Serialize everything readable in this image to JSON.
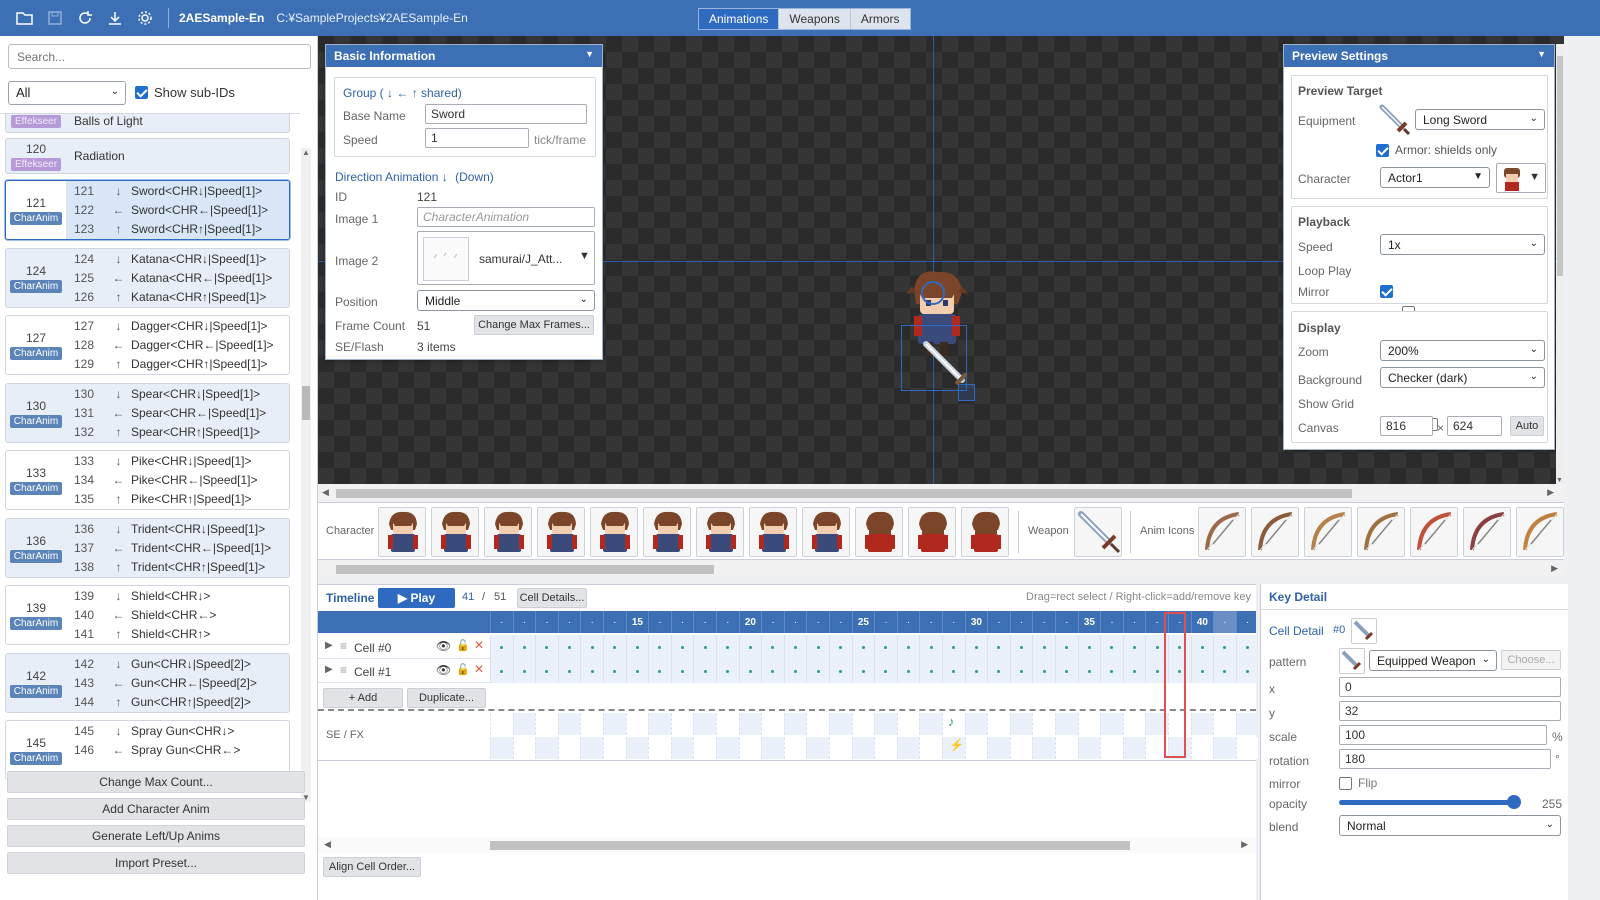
{
  "topbar": {
    "project_name": "2AESample-En",
    "project_path": "C:¥SampleProjects¥2AESample-En",
    "tabs": [
      "Animations",
      "Weapons",
      "Armors"
    ],
    "active_tab": "Animations",
    "icons": [
      "folder-open-icon",
      "save-icon",
      "refresh-icon",
      "download-icon",
      "gear-icon"
    ]
  },
  "sidebar": {
    "search_placeholder": "Search...",
    "filter_value": "All",
    "show_subids_label": "Show sub-IDs",
    "show_subids_checked": true,
    "groups": [
      {
        "id": "",
        "badge": "Effekseer",
        "rows": [
          {
            "id": "",
            "dir": "",
            "name": "Balls of Light"
          }
        ]
      },
      {
        "id": "120",
        "badge": "Effekseer",
        "rows": [
          {
            "id": "",
            "dir": "",
            "name": "Radiation"
          }
        ]
      },
      {
        "id": "121",
        "badge": "CharAnim",
        "rows": [
          {
            "id": "121",
            "dir": "↓",
            "name": "Sword<CHR↓|Speed[1]>"
          },
          {
            "id": "122",
            "dir": "←",
            "name": "Sword<CHR←|Speed[1]>"
          },
          {
            "id": "123",
            "dir": "↑",
            "name": "Sword<CHR↑|Speed[1]>"
          }
        ]
      },
      {
        "id": "124",
        "badge": "CharAnim",
        "rows": [
          {
            "id": "124",
            "dir": "↓",
            "name": "Katana<CHR↓|Speed[1]>"
          },
          {
            "id": "125",
            "dir": "←",
            "name": "Katana<CHR←|Speed[1]>"
          },
          {
            "id": "126",
            "dir": "↑",
            "name": "Katana<CHR↑|Speed[1]>"
          }
        ]
      },
      {
        "id": "127",
        "badge": "CharAnim",
        "rows": [
          {
            "id": "127",
            "dir": "↓",
            "name": "Dagger<CHR↓|Speed[1]>"
          },
          {
            "id": "128",
            "dir": "←",
            "name": "Dagger<CHR←|Speed[1]>"
          },
          {
            "id": "129",
            "dir": "↑",
            "name": "Dagger<CHR↑|Speed[1]>"
          }
        ]
      },
      {
        "id": "130",
        "badge": "CharAnim",
        "rows": [
          {
            "id": "130",
            "dir": "↓",
            "name": "Spear<CHR↓|Speed[1]>"
          },
          {
            "id": "131",
            "dir": "←",
            "name": "Spear<CHR←|Speed[1]>"
          },
          {
            "id": "132",
            "dir": "↑",
            "name": "Spear<CHR↑|Speed[1]>"
          }
        ]
      },
      {
        "id": "133",
        "badge": "CharAnim",
        "rows": [
          {
            "id": "133",
            "dir": "↓",
            "name": "Pike<CHR↓|Speed[1]>"
          },
          {
            "id": "134",
            "dir": "←",
            "name": "Pike<CHR←|Speed[1]>"
          },
          {
            "id": "135",
            "dir": "↑",
            "name": "Pike<CHR↑|Speed[1]>"
          }
        ]
      },
      {
        "id": "136",
        "badge": "CharAnim",
        "rows": [
          {
            "id": "136",
            "dir": "↓",
            "name": "Trident<CHR↓|Speed[1]>"
          },
          {
            "id": "137",
            "dir": "←",
            "name": "Trident<CHR←|Speed[1]>"
          },
          {
            "id": "138",
            "dir": "↑",
            "name": "Trident<CHR↑|Speed[1]>"
          }
        ]
      },
      {
        "id": "139",
        "badge": "CharAnim",
        "rows": [
          {
            "id": "139",
            "dir": "↓",
            "name": "Shield<CHR↓>"
          },
          {
            "id": "140",
            "dir": "←",
            "name": "Shield<CHR←>"
          },
          {
            "id": "141",
            "dir": "↑",
            "name": "Shield<CHR↑>"
          }
        ]
      },
      {
        "id": "142",
        "badge": "CharAnim",
        "rows": [
          {
            "id": "142",
            "dir": "↓",
            "name": "Gun<CHR↓|Speed[2]>"
          },
          {
            "id": "143",
            "dir": "←",
            "name": "Gun<CHR←|Speed[2]>"
          },
          {
            "id": "144",
            "dir": "↑",
            "name": "Gun<CHR↑|Speed[2]>"
          }
        ]
      },
      {
        "id": "145",
        "badge": "CharAnim",
        "rows": [
          {
            "id": "145",
            "dir": "↓",
            "name": "Spray Gun<CHR↓>"
          },
          {
            "id": "146",
            "dir": "←",
            "name": "Spray Gun<CHR←>"
          }
        ]
      }
    ],
    "buttons": [
      "Change Max Count...",
      "Add Character Anim",
      "Generate Left/Up Anims",
      "Import Preset..."
    ]
  },
  "basic_info": {
    "title": "Basic Information",
    "group_label": "Group (",
    "group_dirs": "↓ ← ↑",
    "group_shared": "shared)",
    "base_name_label": "Base Name",
    "base_name_value": "Sword",
    "speed_label": "Speed",
    "speed_value": "1",
    "speed_unit": "tick/frame",
    "direction_label": "Direction Animation",
    "direction_arrow": "↓",
    "direction_name": "(Down)",
    "id_label": "ID",
    "id_value": "121",
    "image1_label": "Image 1",
    "image1_placeholder": "CharacterAnimation",
    "image2_label": "Image 2",
    "image2_value": "samurai/J_Att...",
    "position_label": "Position",
    "position_value": "Middle",
    "frame_count_label": "Frame Count",
    "frame_count_value": "51",
    "change_max_frames": "Change Max Frames...",
    "seflash_label": "SE/Flash",
    "seflash_value": "3 items"
  },
  "preview": {
    "title": "Preview Settings",
    "target_heading": "Preview Target",
    "equipment_label": "Equipment",
    "equipment_value": "Long Sword",
    "armor_label": "Armor: shields only",
    "armor_checked": true,
    "character_label": "Character",
    "character_value": "Actor1",
    "playback_heading": "Playback",
    "speed_label": "Speed",
    "speed_value": "1x",
    "loop_label": "Loop Play",
    "loop_checked": true,
    "mirror_label": "Mirror",
    "mirror_checked": false,
    "display_heading": "Display",
    "zoom_label": "Zoom",
    "zoom_value": "200%",
    "background_label": "Background",
    "background_value": "Checker (dark)",
    "grid_label": "Show Grid",
    "grid_checked": false,
    "canvas_label": "Canvas",
    "canvas_w": "816",
    "canvas_x": "×",
    "canvas_h": "624",
    "auto_label": "Auto"
  },
  "strip": {
    "character_label": "Character",
    "weapon_label": "Weapon",
    "anim_icons_label": "Anim Icons",
    "character_frames": 12,
    "anim_icon_count": 7
  },
  "timeline": {
    "title": "Timeline",
    "play_label": "▶ Play",
    "current_frame": "41",
    "slash": "/",
    "total_frames": "51",
    "cell_details_btn": "Cell Details...",
    "hint": "Drag=rect select / Right-click=add/remove key",
    "tick_labels": [
      "15",
      "20",
      "25",
      "30",
      "35",
      "40"
    ],
    "cells": [
      {
        "name": "Cell #0"
      },
      {
        "name": "Cell #1"
      }
    ],
    "add_btn": "+ Add",
    "duplicate_btn": "Duplicate...",
    "sefx_label": "SE / FX",
    "align_btn": "Align Cell Order..."
  },
  "keydetail": {
    "title": "Key Detail",
    "cell_detail_label": "Cell Detail",
    "cell_index": "#0",
    "pattern_label": "pattern",
    "pattern_value": "Equipped Weapon",
    "choose_btn": "Choose...",
    "x_label": "x",
    "x_value": "0",
    "y_label": "y",
    "y_value": "32",
    "scale_label": "scale",
    "scale_value": "100",
    "scale_unit": "%",
    "rotation_label": "rotation",
    "rotation_value": "180",
    "rotation_unit": "°",
    "mirror_label": "mirror",
    "flip_label": "Flip",
    "flip_checked": false,
    "opacity_label": "opacity",
    "opacity_value": "255",
    "opacity_fraction": 1.0,
    "blend_label": "blend",
    "blend_value": "Normal"
  }
}
